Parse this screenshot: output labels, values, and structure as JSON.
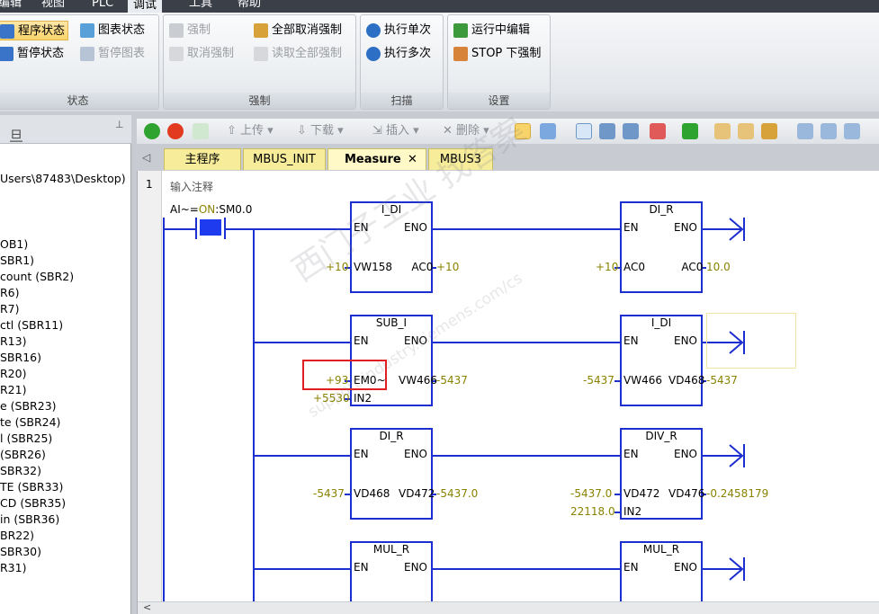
{
  "menu": [
    "编辑",
    "视图",
    "PLC",
    "调试",
    "工具",
    "帮助"
  ],
  "ribbon": {
    "status_group": {
      "caption": "状态",
      "program_status": "程序状态",
      "chart_status": "图表状态",
      "pause_status": "暂停状态",
      "pause_chart": "暂停图表"
    },
    "force_group": {
      "caption": "强制",
      "force": "强制",
      "unforce_all": "全部取消强制",
      "unforce": "取消强制",
      "read_all_forced": "读取全部强制"
    },
    "scan_group": {
      "caption": "扫描",
      "single": "执行单次",
      "multiple": "执行多次"
    },
    "settings_group": {
      "caption": "设置",
      "runtime_edit": "运行中编辑",
      "stop_force": "STOP 下强制"
    }
  },
  "left_panel": {
    "items": [
      "Users\\87483\\Desktop)",
      "OB1)",
      "SBR1)",
      "count (SBR2)",
      "R6)",
      "R7)",
      "ctl (SBR11)",
      "R13)",
      "SBR16)",
      "R20)",
      "R21)",
      "e (SBR23)",
      "te (SBR24)",
      "l (SBR25)",
      "(SBR26)",
      "SBR32)",
      "TE (SBR33)",
      "CD (SBR35)",
      "in (SBR36)",
      "BR22)",
      "SBR30)",
      "R31)"
    ]
  },
  "toolbar": {
    "upload": "上传",
    "download": "下载",
    "insert": "插入",
    "delete": "删除"
  },
  "tabs": [
    "主程序",
    "MBUS_INIT",
    "Measure",
    "MBUS3"
  ],
  "editor": {
    "network_number": "1",
    "comment": "输入注释",
    "contact_label_pre": "AI~=",
    "contact_label_on": "ON",
    "contact_label_post": ":SM0.0",
    "watermark_cn": "西门子工业 找答案",
    "watermark_url": "support.industry.siemens.com/cs",
    "rungs": [
      {
        "b1": {
          "name": "I_DI",
          "en": "EN",
          "eno": "ENO",
          "in": "VW158",
          "out": "AC0",
          "in_val": "+10",
          "out_val": "+10"
        },
        "b2": {
          "name": "DI_R",
          "en": "EN",
          "eno": "ENO",
          "in": "AC0",
          "out": "AC0",
          "in_val": "+10",
          "out_val": "10.0"
        }
      },
      {
        "b1": {
          "name": "SUB_I",
          "en": "EN",
          "eno": "ENO",
          "in": "EM0~",
          "out": "VW466",
          "in_val": "+93",
          "out_val": "-5437",
          "in2": "IN2",
          "in2_val": "+5530"
        },
        "b2": {
          "name": "I_DI",
          "en": "EN",
          "eno": "ENO",
          "in": "VW466",
          "out": "VD468",
          "in_val": "-5437",
          "out_val": "-5437"
        }
      },
      {
        "b1": {
          "name": "DI_R",
          "en": "EN",
          "eno": "ENO",
          "in": "VD468",
          "out": "VD472",
          "in_val": "-5437",
          "out_val": "-5437.0"
        },
        "b2": {
          "name": "DIV_R",
          "en": "EN",
          "eno": "ENO",
          "in": "VD472",
          "out": "VD476",
          "in_val": "-5437.0",
          "out_val": "-0.2458179",
          "in2": "IN2",
          "in2_val": "22118.0"
        }
      },
      {
        "b1": {
          "name": "MUL_R",
          "en": "EN",
          "eno": "ENO"
        },
        "b2": {
          "name": "MUL_R",
          "en": "EN",
          "eno": "ENO"
        }
      }
    ]
  },
  "colors": {
    "wire": "#1c2fd0",
    "value": "#8a8200",
    "highlight": "#e02020"
  }
}
